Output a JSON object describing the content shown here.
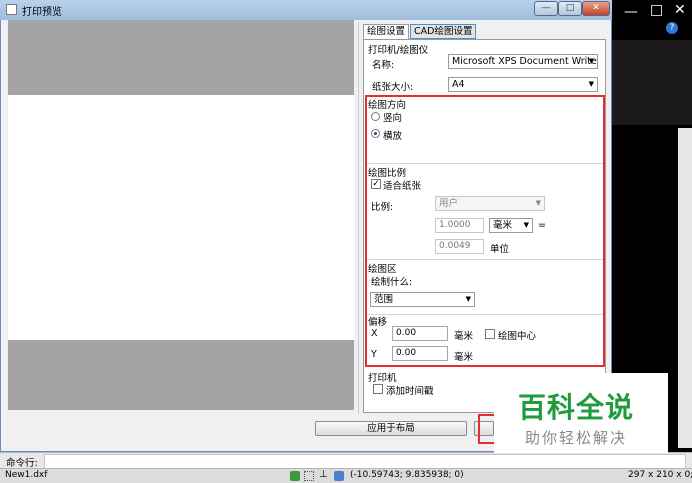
{
  "window": {
    "title": "打印预览",
    "min": "—",
    "max": "□",
    "close": "✕"
  },
  "tabs": [
    {
      "label": "绘图设置",
      "active": true
    },
    {
      "label": "CAD绘图设置",
      "active": false
    }
  ],
  "printer": {
    "group_label": "打印机/绘图仪",
    "name_label": "名称:",
    "name_value": "Microsoft XPS Document Writer",
    "paper_label": "纸张大小:",
    "paper_value": "A4"
  },
  "orientation": {
    "group_label": "绘图方向",
    "portrait": "竖向",
    "landscape": "横放",
    "selected": "landscape"
  },
  "scale": {
    "group_label": "绘图比例",
    "fit_label": "适合纸张",
    "fit_checked": true,
    "ratio_label": "比例:",
    "ratio_value": "用户",
    "mm_value": "1.0000",
    "unit_select": "毫米",
    "equals": "=",
    "units_value": "0.0049",
    "units_label": "单位"
  },
  "area": {
    "group_label": "绘图区",
    "what_label": "绘制什么:",
    "what_value": "范围"
  },
  "offset": {
    "group_label": "偏移",
    "x_label": "X",
    "x_value": "0.00",
    "x_unit": "毫米",
    "center_label": "绘图中心",
    "center_checked": false,
    "y_label": "Y",
    "y_value": "0.00",
    "y_unit": "毫米"
  },
  "plotter": {
    "group_label": "打印机",
    "timestamp_label": "添加时间戳",
    "timestamp_checked": false
  },
  "buttons": {
    "apply_layout": "应用于布局"
  },
  "command": {
    "label": "命令行:"
  },
  "status": {
    "file": "New1.dxf",
    "coords": "(-10.59743; 9.835938; 0)",
    "paper_size": "297 x 210 x 0;"
  },
  "watermark": {
    "main": "百科全说",
    "sub": "助你轻松解决"
  },
  "colors": {
    "highlight": "#e03030",
    "watermark": "#1e9b3c"
  }
}
